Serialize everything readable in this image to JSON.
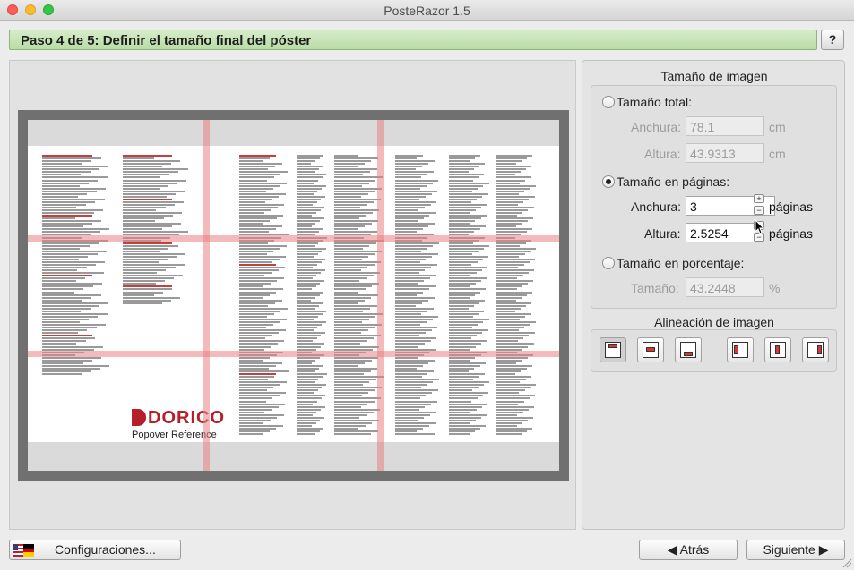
{
  "window": {
    "title": "PosteRazor 1.5"
  },
  "step": {
    "title": "Paso 4 de 5: Definir el tamaño final del póster",
    "help_label": "?"
  },
  "preview": {
    "logo_text": "DORICO",
    "logo_subtitle": "Popover Reference",
    "colors": {
      "overlap_lines": "#e88282",
      "poster_border": "#707070"
    }
  },
  "image_size": {
    "title": "Tamaño de imagen",
    "total": {
      "label": "Tamaño total:",
      "width_label": "Anchura:",
      "width_value": "78.1",
      "width_unit": "cm",
      "height_label": "Altura:",
      "height_value": "43.9313",
      "height_unit": "cm",
      "selected": false
    },
    "pages": {
      "label": "Tamaño en páginas:",
      "width_label": "Anchura:",
      "width_value": "3",
      "width_unit": "páginas",
      "height_label": "Altura:",
      "height_value": "2.5254",
      "height_unit": "páginas",
      "selected": true
    },
    "percent": {
      "label": "Tamaño en porcentaje:",
      "size_label": "Tamaño:",
      "size_value": "43.2448",
      "size_unit": "%",
      "selected": false
    }
  },
  "alignment": {
    "title": "Alineación de imagen",
    "buttons": [
      {
        "name": "top",
        "pressed": true
      },
      {
        "name": "center",
        "pressed": false
      },
      {
        "name": "bottom",
        "pressed": false
      },
      {
        "name": "left",
        "pressed": false
      },
      {
        "name": "middle",
        "pressed": false
      },
      {
        "name": "right",
        "pressed": false
      }
    ]
  },
  "footer": {
    "settings_label": "Configuraciones...",
    "back_label": "Atrás",
    "next_label": "Siguiente"
  }
}
